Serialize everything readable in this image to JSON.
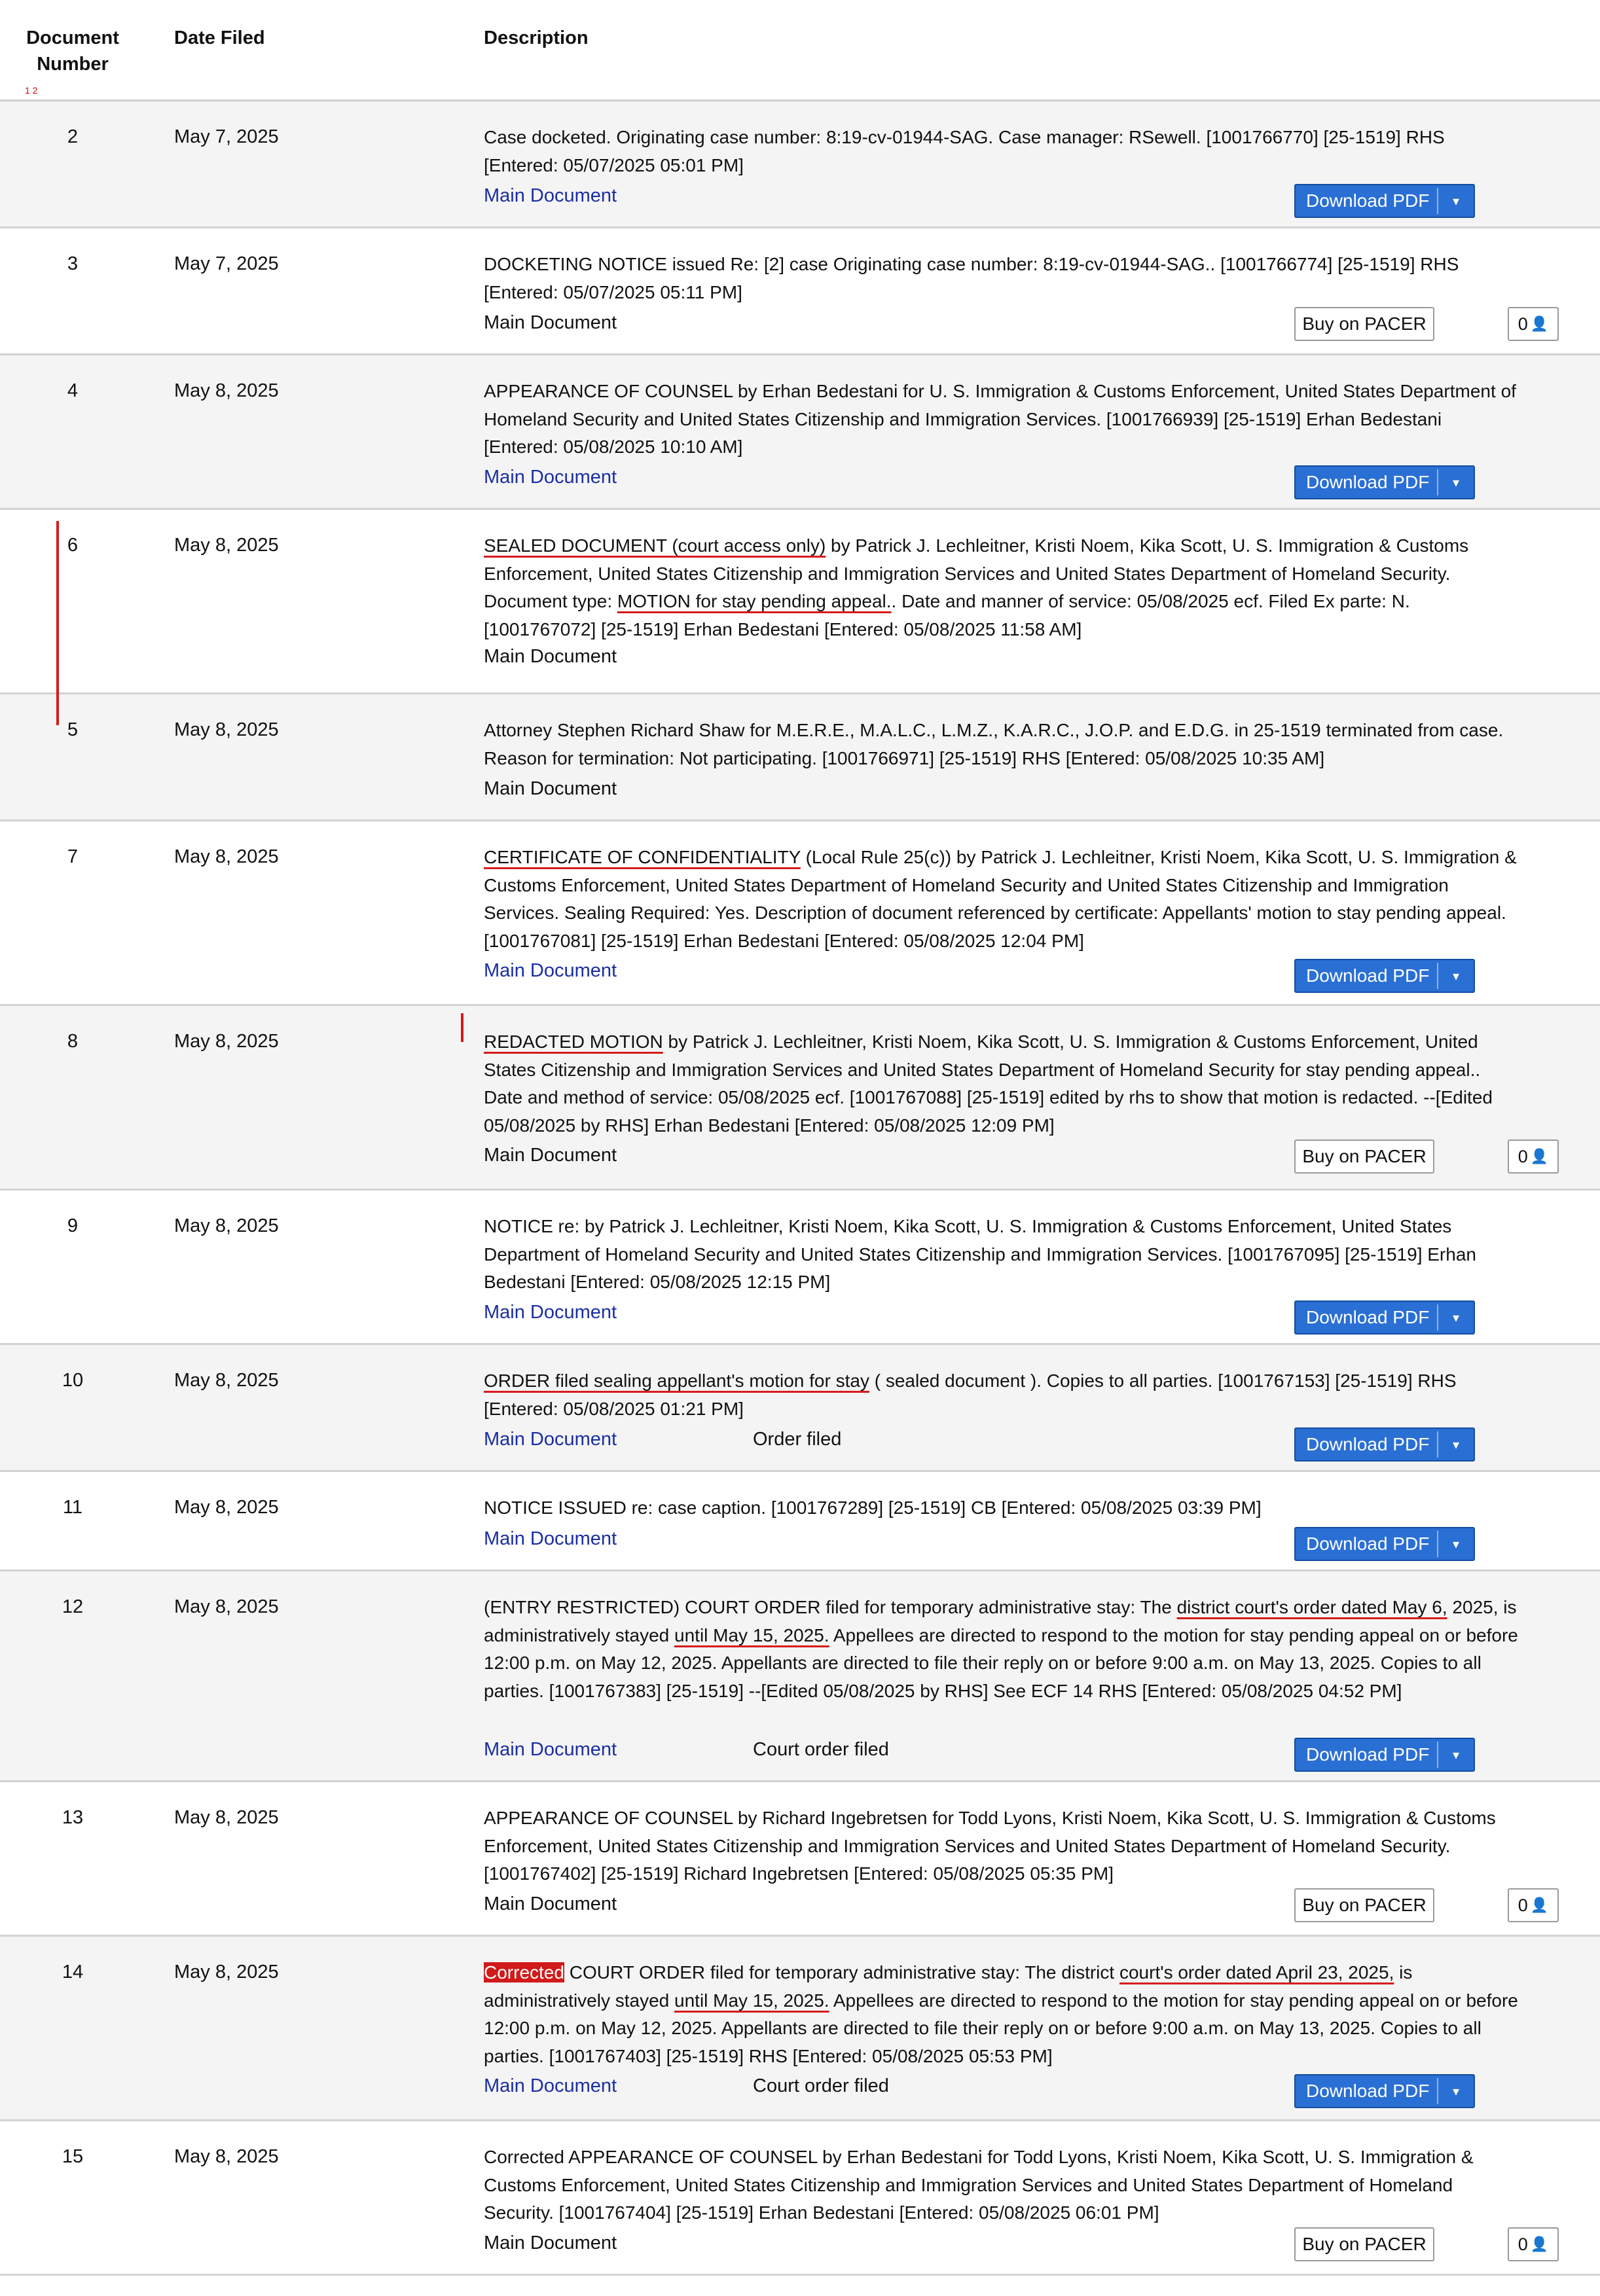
{
  "header": {
    "num": "Document\nNumber",
    "date": "Date Filed",
    "desc": "Description",
    "mark": "1 2"
  },
  "labels": {
    "main": "Main Document",
    "download": "Download PDF",
    "buy": "Buy on PACER",
    "count": "0"
  },
  "accent_colors": {
    "button": "#2a6fd4",
    "link": "#1a2ea3",
    "annotation": "#d71b1b"
  },
  "icons": {
    "download_menu": "caret-down-icon",
    "count": "users-icon"
  },
  "rows": [
    {
      "num": "2",
      "date": "May 7, 2025",
      "desc": "Case docketed. Originating case number: 8:19-cv-01944-SAG. Case manager: RSewell. [1001766770] [25-1519] RHS [Entered: 05/07/2025 05:01 PM]",
      "action": "download",
      "link": true
    },
    {
      "num": "3",
      "date": "May 7, 2025",
      "desc": "DOCKETING NOTICE issued Re: [2] case Originating case number: 8:19-cv-01944-SAG.. [1001766774] [25-1519] RHS [Entered: 05/07/2025 05:11 PM]",
      "action": "buy",
      "link": false
    },
    {
      "num": "4",
      "date": "May 8, 2025",
      "desc": "APPEARANCE OF COUNSEL by Erhan Bedestani for U. S. Immigration & Customs Enforcement, United States Department of Homeland Security and United States Citizenship and Immigration Services. [1001766939] [25-1519] Erhan Bedestani [Entered: 05/08/2025 10:10 AM]",
      "action": "download",
      "link": true
    },
    {
      "num": "6",
      "date": "May 8, 2025",
      "desc": "SEALED DOCUMENT (court access only) by Patrick J. Lechleitner, Kristi Noem, Kika Scott, U. S. Immigration & Customs Enforcement, United States Citizenship and Immigration Services and United States Department of Homeland Security. Document type: MOTION for stay pending appeal.. Date and manner of service: 05/08/2025 ecf. Filed Ex parte: N. [1001767072] [25-1519] Erhan Bedestani [Entered: 05/08/2025 11:58 AM]",
      "action": "none",
      "link": false
    },
    {
      "num": "5",
      "date": "May 8, 2025",
      "desc": "Attorney Stephen Richard Shaw for M.E.R.E., M.A.L.C., L.M.Z., K.A.R.C., J.O.P. and E.D.G. in 25-1519 terminated from case. Reason for termination: Not participating. [1001766971] [25-1519] RHS [Entered: 05/08/2025 10:35 AM]",
      "action": "none",
      "link": false
    },
    {
      "num": "7",
      "date": "May 8, 2025",
      "desc": "CERTIFICATE OF CONFIDENTIALITY (Local Rule 25(c)) by Patrick J. Lechleitner, Kristi Noem, Kika Scott, U. S. Immigration & Customs Enforcement, United States Department of Homeland Security and United States Citizenship and Immigration Services. Sealing Required: Yes. Description of document referenced by certificate: Appellants' motion to stay pending appeal. [1001767081] [25-1519] Erhan Bedestani [Entered: 05/08/2025 12:04 PM]",
      "action": "download",
      "link": true
    },
    {
      "num": "8",
      "date": "May 8, 2025",
      "desc": "REDACTED MOTION by Patrick J. Lechleitner, Kristi Noem, Kika Scott, U. S. Immigration & Customs Enforcement, United States Citizenship and Immigration Services and United States Department of Homeland Security for stay pending appeal.. Date and method of service: 05/08/2025 ecf. [1001767088] [25-1519] edited by rhs to show that motion is redacted. --[Edited 05/08/2025 by RHS] Erhan Bedestani [Entered: 05/08/2025 12:09 PM]",
      "action": "buy",
      "link": false
    },
    {
      "num": "9",
      "date": "May 8, 2025",
      "desc": "NOTICE re: by Patrick J. Lechleitner, Kristi Noem, Kika Scott, U. S. Immigration & Customs Enforcement, United States Department of Homeland Security and United States Citizenship and Immigration Services. [1001767095] [25-1519] Erhan Bedestani [Entered: 05/08/2025 12:15 PM]",
      "action": "download",
      "link": true
    },
    {
      "num": "10",
      "date": "May 8, 2025",
      "desc": "ORDER filed sealing appellant's motion for stay ( sealed document ). Copies to all parties. [1001767153] [25-1519] RHS [Entered: 05/08/2025 01:21 PM]",
      "action": "download",
      "link": true,
      "extra": "Order filed"
    },
    {
      "num": "11",
      "date": "May 8, 2025",
      "desc": "NOTICE ISSUED re: case caption. [1001767289] [25-1519] CB [Entered: 05/08/2025 03:39 PM]",
      "action": "download",
      "link": true
    },
    {
      "num": "12",
      "date": "May 8, 2025",
      "desc": "(ENTRY RESTRICTED) COURT ORDER filed for temporary administrative stay: The district court's order dated May 6, 2025, is administratively stayed until May 15, 2025. Appellees are directed to respond to the motion for stay pending appeal on or before 12:00 p.m. on May 12, 2025. Appellants are directed to file their reply on or before 9:00 a.m. on May 13, 2025. Copies to all parties. [1001767383] [25-1519] --[Edited 05/08/2025 by RHS] See ECF 14 RHS [Entered: 05/08/2025 04:52 PM]",
      "action": "download",
      "link": true,
      "extra": "Court order filed"
    },
    {
      "num": "13",
      "date": "May 8, 2025",
      "desc": "APPEARANCE OF COUNSEL by Richard Ingebretsen for Todd Lyons, Kristi Noem, Kika Scott, U. S. Immigration & Customs Enforcement, United States Citizenship and Immigration Services and United States Department of Homeland Security. [1001767402] [25-1519] Richard Ingebretsen [Entered: 05/08/2025 05:35 PM]",
      "action": "buy",
      "link": false
    },
    {
      "num": "14",
      "date": "May 8, 2025",
      "desc": "Corrected COURT ORDER filed for temporary administrative stay: The district court's order dated April 23, 2025, is administratively stayed until May 15, 2025. Appellees are directed to respond to the motion for stay pending appeal on or before 12:00 p.m. on May 12, 2025. Appellants are directed to file their reply on or before 9:00 a.m. on May 13, 2025. Copies to all parties. [1001767403] [25-1519] RHS [Entered: 05/08/2025 05:53 PM]",
      "action": "download",
      "link": true,
      "extra": "Court order filed"
    },
    {
      "num": "15",
      "date": "May 8, 2025",
      "desc": "Corrected APPEARANCE OF COUNSEL by Erhan Bedestani for Todd Lyons, Kristi Noem, Kika Scott, U. S. Immigration & Customs Enforcement, United States Citizenship and Immigration Services and United States Department of Homeland Security. [1001767404] [25-1519] Erhan Bedestani [Entered: 05/08/2025 06:01 PM]",
      "action": "buy",
      "link": false
    }
  ]
}
